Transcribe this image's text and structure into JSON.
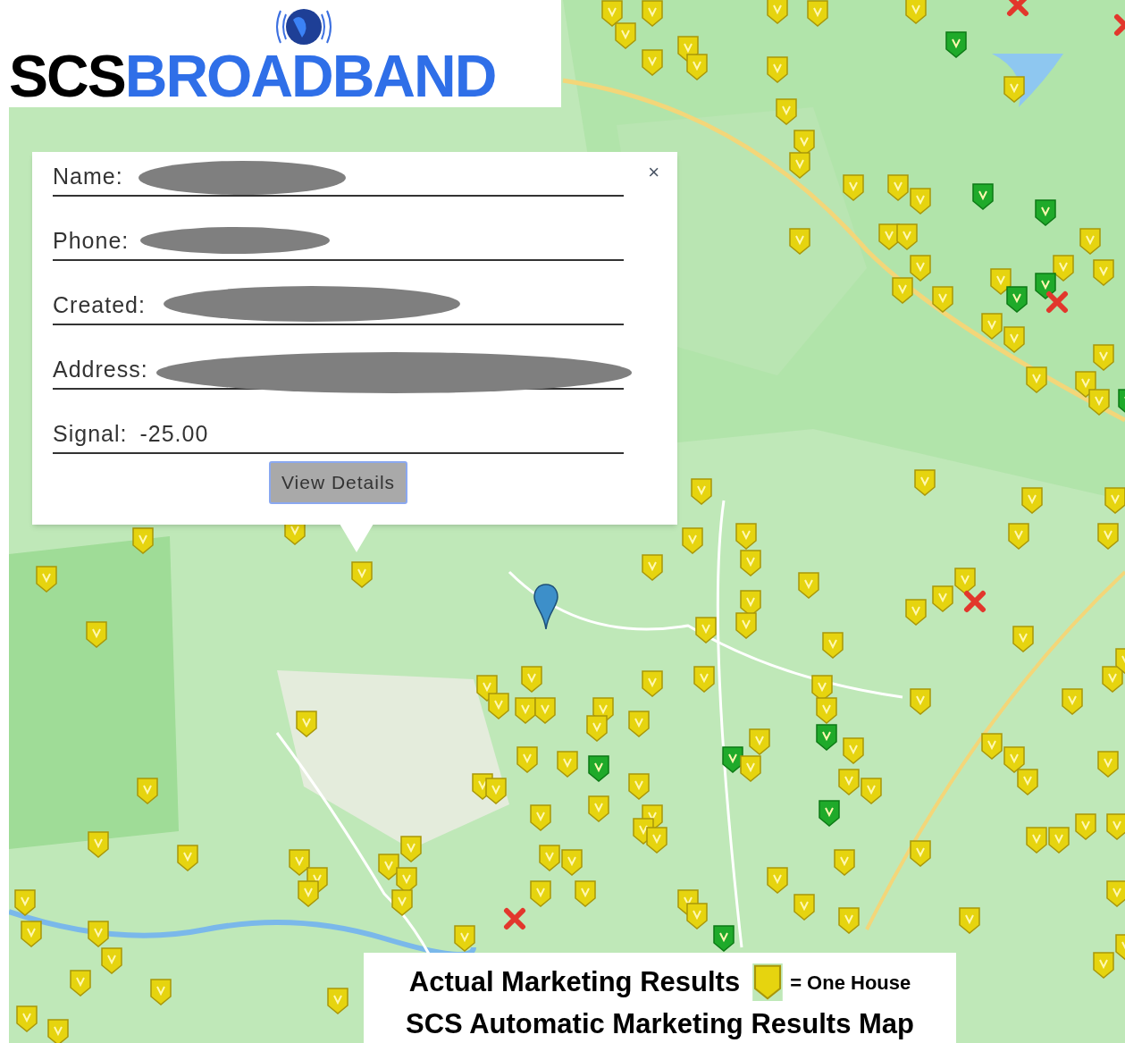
{
  "logo": {
    "prefix": "SCS",
    "name": "BROADBAND"
  },
  "popup": {
    "close": "×",
    "fields": [
      {
        "label": "Name:",
        "redacted": true
      },
      {
        "label": "Phone:",
        "redacted": true
      },
      {
        "label": "Created:",
        "redacted": true
      },
      {
        "label": "Address:",
        "redacted": true
      },
      {
        "label": "Signal:",
        "value": "-25.00",
        "redacted": false
      }
    ],
    "button": "View Details"
  },
  "legend": {
    "title": "Actual Marketing Results",
    "key": "= One House",
    "subtitle": "SCS Automatic Marketing Results Map"
  }
}
